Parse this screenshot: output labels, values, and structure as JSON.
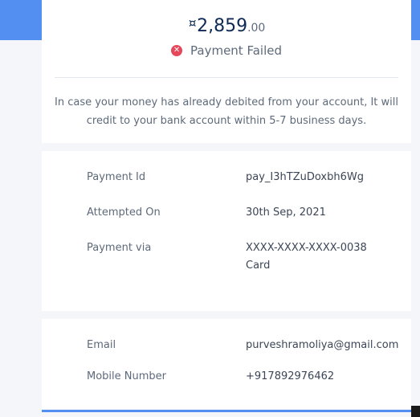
{
  "summary": {
    "currency_symbol": "¤",
    "amount_main": "2,859",
    "amount_decimal": ".00",
    "status": "Payment Failed",
    "status_icon": "error-x-icon",
    "status_color": "#e5485b",
    "note": "In case your money has already debited from your account, It will credit to your bank account within 5-7 business days."
  },
  "details": [
    {
      "label": "Payment Id",
      "value": "pay_I3hTZuDoxbh6Wg"
    },
    {
      "label": "Attempted On",
      "value": "30th Sep, 2021"
    },
    {
      "label": "Payment via",
      "value": "XXXX-XXXX-XXXX-0038",
      "value2": "Card"
    }
  ],
  "contact": [
    {
      "label": "Email",
      "value": "purveshramoliya@gmail.com"
    },
    {
      "label": "Mobile Number",
      "value": "+917892976462"
    }
  ],
  "colors": {
    "accent": "#528ff0",
    "link": "#3d85d8"
  }
}
